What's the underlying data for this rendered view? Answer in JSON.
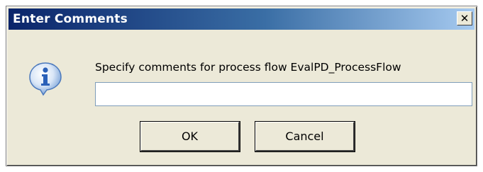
{
  "window": {
    "title": "Enter Comments",
    "close_glyph": "✕",
    "close_icon": "close-icon"
  },
  "dialog": {
    "icon": "info-icon",
    "prompt": "Specify comments for process flow EvalPD_ProcessFlow",
    "comment_value": "",
    "comment_placeholder": ""
  },
  "buttons": {
    "ok_label": "OK",
    "cancel_label": "Cancel"
  },
  "colors": {
    "titlebar_start": "#0a246a",
    "titlebar_end": "#a6caf0",
    "dialog_bg": "#ece9d8",
    "icon_blue": "#2a60b8"
  }
}
